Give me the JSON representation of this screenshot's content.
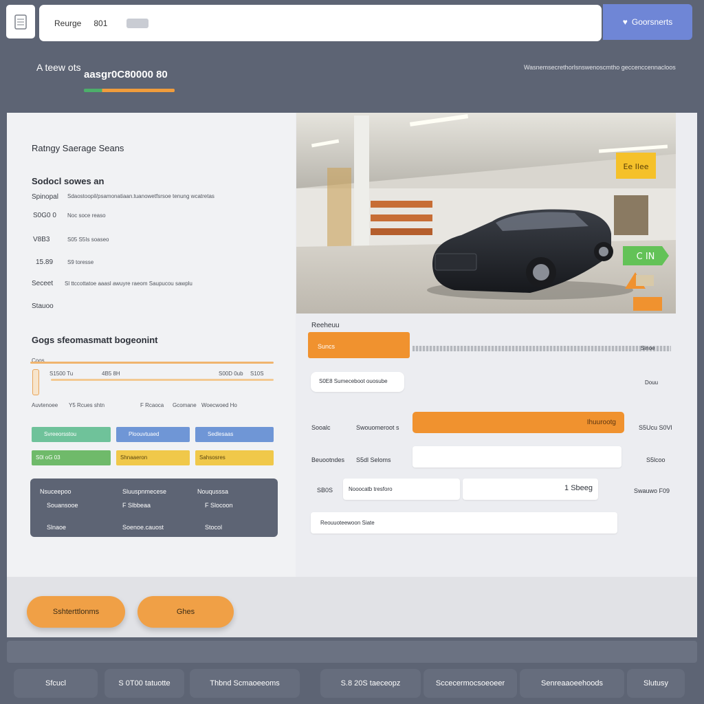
{
  "toolbar": {
    "search_label": "Reurge",
    "search_value": "801",
    "chip": "",
    "cta_label": "Goorsnerts"
  },
  "header": {
    "title": "A teew ots",
    "subtitle": "aasgr0C80000 80",
    "right_text": "Wasnemsecrethorlsnswenoscmtho geccenccennacloos"
  },
  "left": {
    "section1_title": "Ratngy Saerage Seans",
    "section2_title": "Sodocl sowes an",
    "rows": [
      {
        "key": "Spinopal",
        "value": "Sdaostoopil/psamonatiaan.tuanowetfsrsoe tenung wcatretas"
      },
      {
        "key": "S0G0 0",
        "value": "Noc soce reaso"
      },
      {
        "key": "V8B3",
        "value": "S05 S5Is soaseo"
      },
      {
        "key": "15.89",
        "value": "S9 toresse"
      },
      {
        "key": "Seceet",
        "value": "Sl ttccottatoe aaasl awuyre raeom Saupucou sawplu"
      },
      {
        "key": "Stauoo",
        "value": ""
      }
    ],
    "section3_title": "Gogs sfeomasmatt bogeonint",
    "slider": {
      "label": "Coos",
      "left_val": "S1500 Tu",
      "mid_val": "4B5 8H",
      "right_val1": "S00D 0ub",
      "right_val2": "S10S",
      "caption": "Auvtenoee",
      "opt1": "Y5 Rcues shtn",
      "opt2": "F Rcaoca",
      "opt3": "Gcomane",
      "opt4": "Woecwoed Ho"
    },
    "tags": [
      {
        "label": "Svreeorsstou",
        "color": "#6fc29a"
      },
      {
        "label": "Ploouvtuaed",
        "color": "#6f96d6"
      },
      {
        "label": "Sedlesaas",
        "color": "#6f96d6"
      },
      {
        "label": "S0l oG 03",
        "color": "#6fba6a"
      },
      {
        "label": "Shnaaeron",
        "color": "#f0c84a"
      },
      {
        "label": "Sahsosres",
        "color": "#f0c84a"
      }
    ],
    "table": {
      "head": [
        "Nsuceepoo",
        "Sluuspnmecese",
        "Nouqusssa"
      ],
      "row1": [
        "Souansooe",
        "F Slbbeaa",
        "F Slocoon"
      ],
      "row2": [
        "Slnaoe",
        "Soenoe.cauost",
        "Stocol"
      ]
    }
  },
  "photo": {
    "sign": "Ee Ilee",
    "badge": "C IN"
  },
  "right": {
    "section_label": "Reeheuu",
    "tab_orange": "Suncs",
    "tab_right": "Sinoe",
    "pill": "S0E8 Sumeceboot ouosube",
    "pill_right": "Douu",
    "rows": [
      {
        "label": "Sooalc",
        "mid": "Swouomeroot s",
        "field": "Ihuurootg",
        "right": "S5Ucu S0Vl"
      },
      {
        "label": "Beuootndes",
        "mid": "S5dl Seloms",
        "field": "",
        "right": "S5lcoo"
      },
      {
        "label": "SB0S",
        "mid": "Nooocatb tresforo",
        "field": "1 Sbeeg",
        "right": "Swauwo F09"
      },
      {
        "label": "",
        "mid": "Reouuoteewoon Siate",
        "field": "",
        "right": ""
      }
    ]
  },
  "actions": {
    "primary": "Sshterttlonms",
    "secondary": "Ghes"
  },
  "taskbar": [
    {
      "label": "Sfcucl"
    },
    {
      "label": "S 0T00 tatuotte"
    },
    {
      "label": "Thbnd Scmaoeeoms"
    },
    {
      "label": "S.8 20S taeceopz"
    },
    {
      "label": "Sccecermocsoeoeer"
    },
    {
      "label": "Senreaaoeehoods"
    },
    {
      "label": "Slutusy"
    }
  ]
}
